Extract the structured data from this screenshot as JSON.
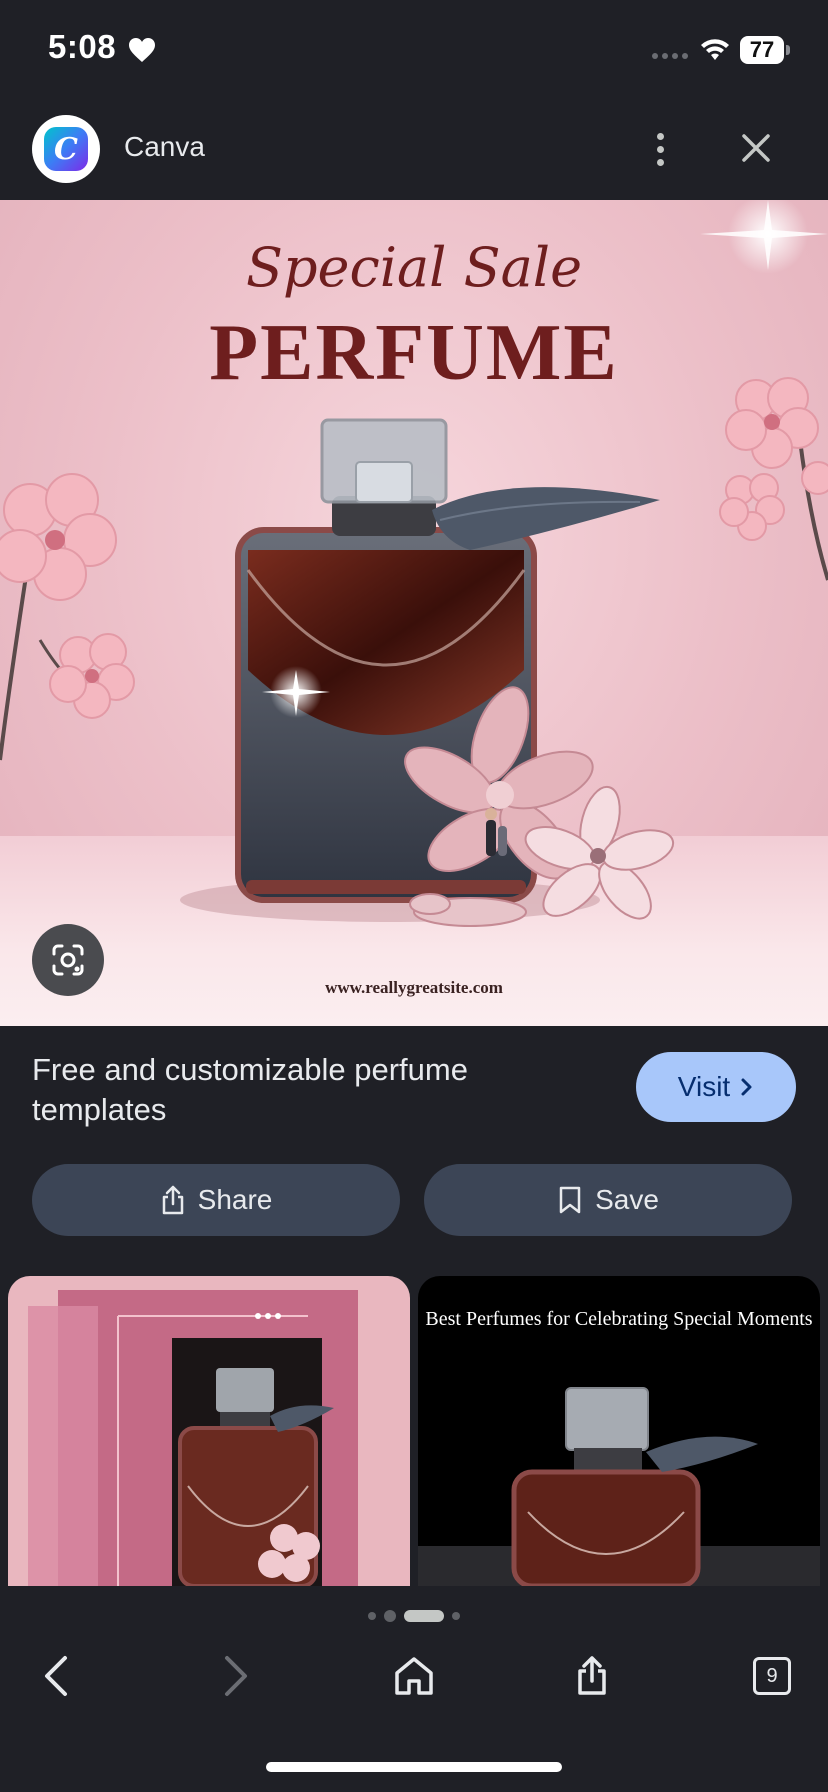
{
  "status_bar": {
    "time": "5:08",
    "battery": "77",
    "icons": [
      "heart-icon",
      "signal-icon",
      "wifi-icon",
      "battery-icon"
    ]
  },
  "app_bar": {
    "title": "Canva",
    "logo_letter": "C",
    "icons": [
      "more-options-icon",
      "close-icon"
    ]
  },
  "hero": {
    "script_text": "Special Sale",
    "headline": "PERFUME",
    "url": "www.reallygreatsite.com",
    "lens_icon": "lens-search-icon"
  },
  "result": {
    "title": "Free and customizable perfume templates",
    "visit_label": "Visit"
  },
  "actions": {
    "share_label": "Share",
    "save_label": "Save"
  },
  "related": [
    {
      "caption": ""
    },
    {
      "caption": "Best Perfumes for Celebrating Special Moments"
    }
  ],
  "bottom_nav": {
    "tab_count": "9",
    "icons": [
      "back-icon",
      "forward-icon",
      "home-icon",
      "share-icon",
      "tabs-icon"
    ]
  },
  "colors": {
    "background": "#1f2026",
    "visit_button": "#a8c7fa",
    "action_button": "#3c4556",
    "headline": "#6e1e1e"
  }
}
